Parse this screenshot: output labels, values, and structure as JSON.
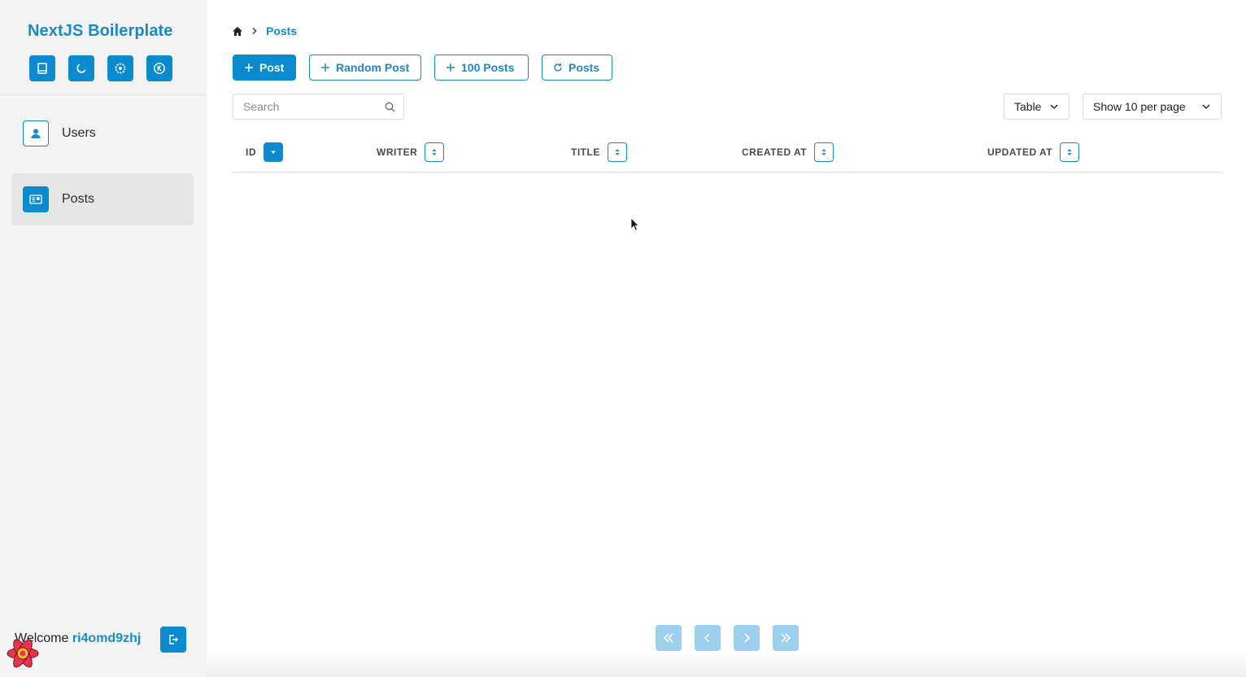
{
  "sidebar": {
    "brand": "NextJS Boilerplate",
    "quick_actions": [
      {
        "icon": "book-icon"
      },
      {
        "icon": "moon-icon"
      },
      {
        "icon": "gear-icon"
      },
      {
        "icon": "k-icon"
      }
    ],
    "items": [
      {
        "label": "Users",
        "icon": "user-icon",
        "active": false
      },
      {
        "label": "Posts",
        "icon": "newspaper-icon",
        "active": true
      }
    ],
    "welcome_prefix": "Welcome",
    "username": "ri4omd9zhj"
  },
  "breadcrumb": {
    "home_icon": "home-icon",
    "current": "Posts"
  },
  "toolbar": {
    "add_post": "Post",
    "random_post": "Random Post",
    "hundred_posts": "100 Posts",
    "refresh_posts": "Posts"
  },
  "search": {
    "placeholder": "Search",
    "value": ""
  },
  "view_select": {
    "value": "Table"
  },
  "per_page_select": {
    "value": "Show 10 per page"
  },
  "table": {
    "columns": [
      "ID",
      "WRITER",
      "TITLE",
      "CREATED AT",
      "UPDATED AT"
    ],
    "sorted_column": "ID",
    "rows": []
  },
  "pagination": {
    "buttons": [
      "first-page",
      "prev-page",
      "next-page",
      "last-page"
    ],
    "disabled": true
  },
  "colors": {
    "accent": "#0b8ad0",
    "brand_text": "#1a8ac7",
    "sidebar_bg": "#f3f3f3",
    "pager_disabled": "#9ccfee"
  }
}
